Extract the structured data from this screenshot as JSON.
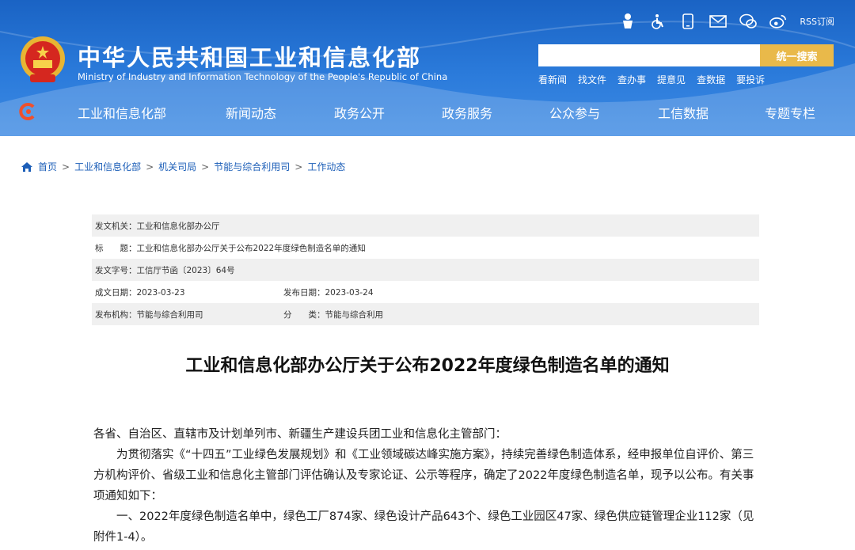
{
  "header": {
    "title": "中华人民共和国工业和信息化部",
    "subtitle": "Ministry of Industry and Information Technology of the People's Republic of China",
    "rss_label": "RSS订阅",
    "search": {
      "placeholder": "",
      "button_label": "统一搜索"
    },
    "quick_links": [
      "看新闻",
      "找文件",
      "查办事",
      "提意见",
      "查数据",
      "要投诉"
    ],
    "icons": [
      "accessibility-mascot-icon",
      "wheelchair-icon",
      "mobile-icon",
      "mail-icon",
      "wechat-icon",
      "weibo-icon"
    ]
  },
  "nav": [
    "工业和信息化部",
    "新闻动态",
    "政务公开",
    "政务服务",
    "公众参与",
    "工信数据",
    "专题专栏"
  ],
  "breadcrumb": [
    "首页",
    "工业和信息化部",
    "机关司局",
    "节能与综合利用司",
    "工作动态"
  ],
  "meta": {
    "issuer": "发文机关：工业和信息化部办公厅",
    "title": "标　　题：工业和信息化部办公厅关于公布2022年度绿色制造名单的通知",
    "doc_no": "发文字号：工信厅节函〔2023〕64号",
    "created": "成文日期：2023-03-23",
    "published": "发布日期：2023-03-24",
    "org": "发布机构：节能与综合利用司",
    "category": "分　　类：节能与综合利用"
  },
  "article": {
    "title": "工业和信息化部办公厅关于公布2022年度绿色制造名单的通知",
    "salutation": "各省、自治区、直辖市及计划单列市、新疆生产建设兵团工业和信息化主管部门：",
    "para1": "为贯彻落实《“十四五”工业绿色发展规划》和《工业领域碳达峰实施方案》，持续完善绿色制造体系，经申报单位自评价、第三方机构评价、省级工业和信息化主管部门评估确认及专家论证、公示等程序，确定了2022年度绿色制造名单，现予以公布。有关事项通知如下：",
    "para2": "一、2022年度绿色制造名单中，绿色工厂874家、绿色设计产品643个、绿色工业园区47家、绿色供应链管理企业112家（见附件1-4）。"
  },
  "colors": {
    "header_blue": "#2b7bdb",
    "search_button": "#e9b94a",
    "link_blue": "#1d5fb8"
  }
}
